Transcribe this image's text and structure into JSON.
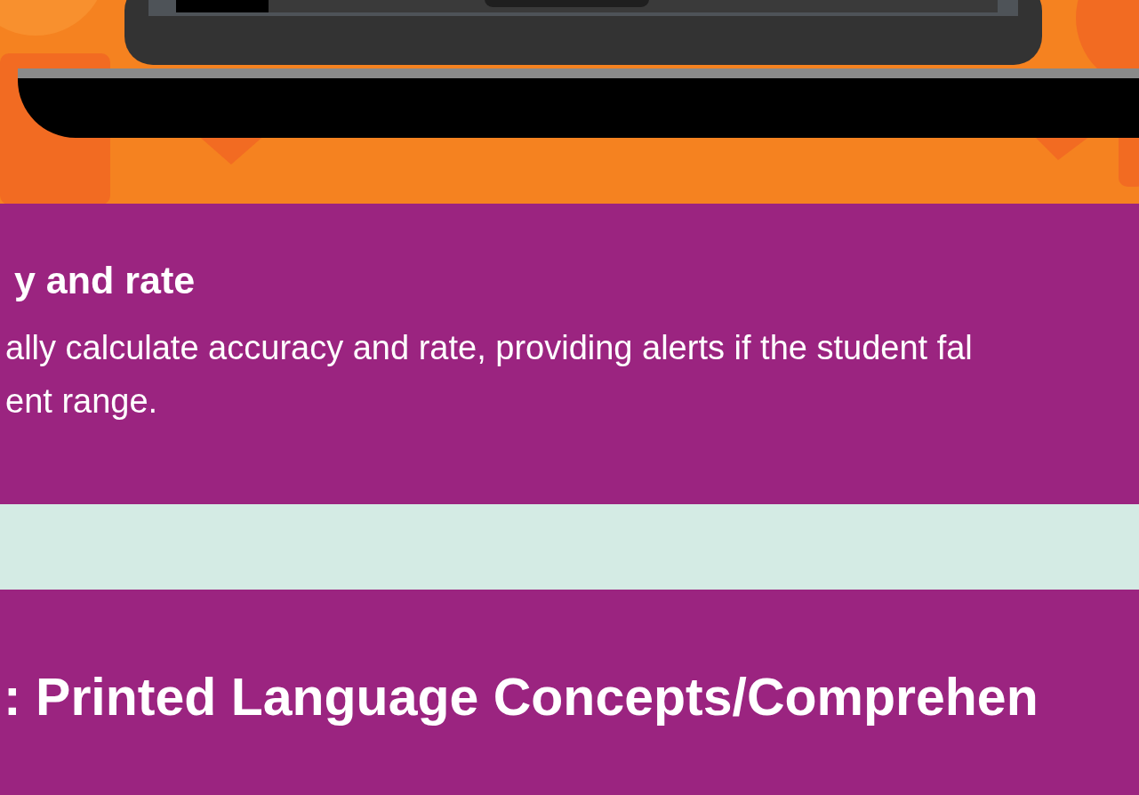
{
  "feature": {
    "heading": "y and rate",
    "text": "ally calculate accuracy and rate, providing alerts if the student fal\nent range."
  },
  "section": {
    "heading": ": Printed Language Concepts/Comprehen"
  }
}
